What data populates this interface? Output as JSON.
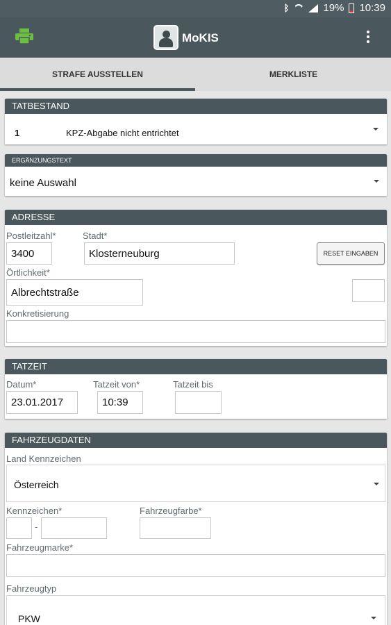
{
  "statusbar": {
    "battery": "19%",
    "time": "10:39"
  },
  "app": {
    "title": "MoKIS"
  },
  "tabs": [
    {
      "label": "STRAFE AUSSTELLEN",
      "active": true
    },
    {
      "label": "MERKLISTE",
      "active": false
    }
  ],
  "tatbestand": {
    "header": "TATBESTAND",
    "selected_code": "1",
    "selected_text": "KPZ-Abgabe nicht entrichtet"
  },
  "ergaenzung": {
    "header": "ERGÄNZUNGSTEXT",
    "selected": "keine Auswahl"
  },
  "adresse": {
    "header": "ADRESSE",
    "plz_label": "Postleitzahl*",
    "plz_value": "3400",
    "stadt_label": "Stadt*",
    "stadt_value": "Klosterneuburg",
    "reset_label": "RESET EINGABEN",
    "oertlichkeit_label": "Örtlichkeit*",
    "oertlichkeit_value": "Albrechtstraße",
    "hausnummer_value": "",
    "konkretisierung_label": "Konkretisierung",
    "konkretisierung_value": ""
  },
  "tatzeit": {
    "header": "TATZEIT",
    "datum_label": "Datum*",
    "datum_value": "23.01.2017",
    "von_label": "Tatzeit von*",
    "von_value": "10:39",
    "bis_label": "Tatzeit bis",
    "bis_value": ""
  },
  "fahrzeug": {
    "header": "FAHRZEUGDATEN",
    "land_label": "Land Kennzeichen",
    "land_value": "Österreich",
    "kennzeichen_label": "Kennzeichen*",
    "kennzeichen_dash": "-",
    "farbe_label": "Fahrzeugfarbe*",
    "marke_label": "Fahrzeugmarke*",
    "typ_label": "Fahrzeugtyp",
    "typ_value": "PKW"
  },
  "colors": {
    "primary": "#4a585d",
    "print_icon": "#6bc13f",
    "battery_low": "#e53935"
  },
  "icons": [
    "bluetooth-icon",
    "wifi-icon",
    "signal-icon",
    "battery-icon",
    "print-icon",
    "app-logo-icon",
    "overflow-menu-icon",
    "dropdown-caret-icon"
  ]
}
